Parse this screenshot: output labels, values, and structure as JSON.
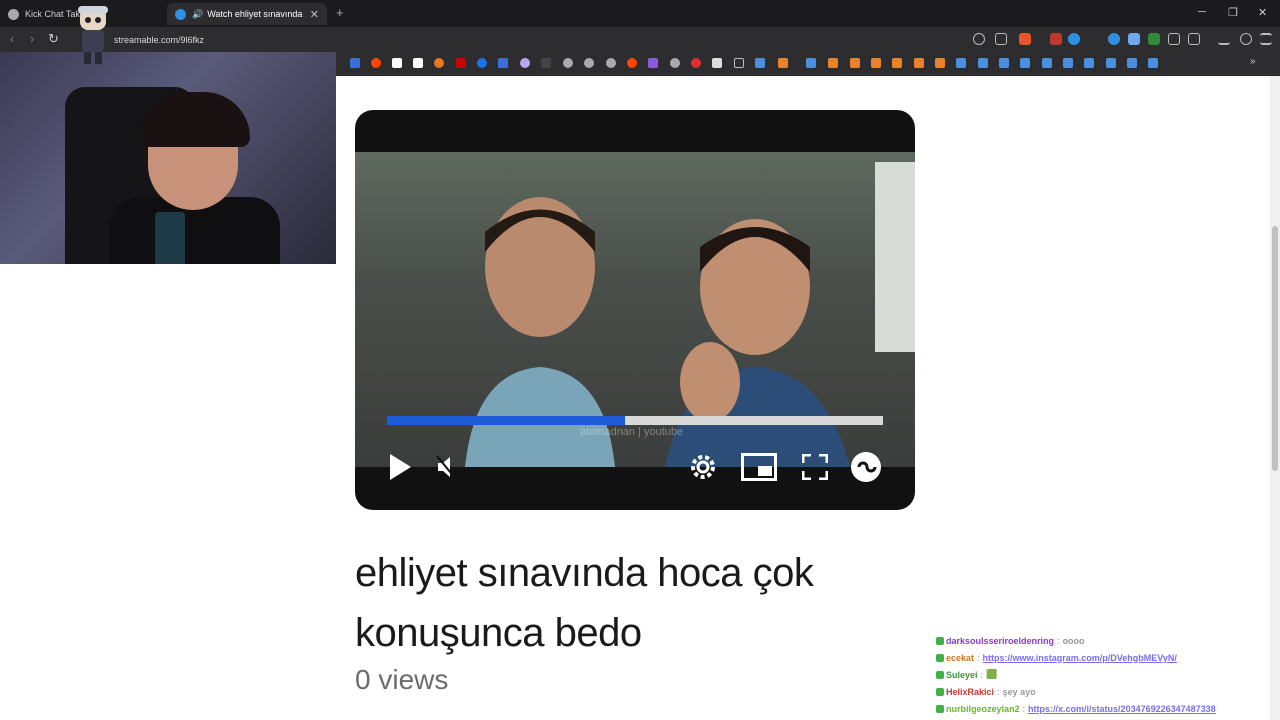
{
  "browser": {
    "tabs": [
      {
        "title": "Kick Chat Takip",
        "active": false
      },
      {
        "title": "Watch ehliyet sınavında hoca",
        "active": true
      }
    ],
    "new_tab_label": "+",
    "url": "streamable.com/9l6fkz",
    "window_controls": {
      "minimize": "─",
      "restore": "❐",
      "close": "✕"
    }
  },
  "video": {
    "progress_fraction": 0.48,
    "watermark": "atomadnan | youtube",
    "accent_color": "#1e5bd8"
  },
  "page": {
    "title": "ehliyet sınavında hoca çok konuşunca bedo",
    "views": "0 views"
  },
  "chat": [
    {
      "user": "darksoulsseriroeldenring",
      "text": "oooo",
      "user_color": "#8a3bd0"
    },
    {
      "user": "ecekat",
      "text": "https://www.instagram.com/p/DVehgbMEVyN/",
      "user_color": "#c47a2c",
      "link": true
    },
    {
      "user": "Suleyei",
      "text": "🟩",
      "user_color": "#3a9a3a"
    },
    {
      "user": "HelixRakici",
      "text": "şey ayo",
      "user_color": "#c0392b"
    },
    {
      "user": "nurbilgeozeylan2",
      "text": "https://x.com/i/status/2034769226347487338",
      "user_color": "#6bb82c",
      "link": true
    }
  ]
}
